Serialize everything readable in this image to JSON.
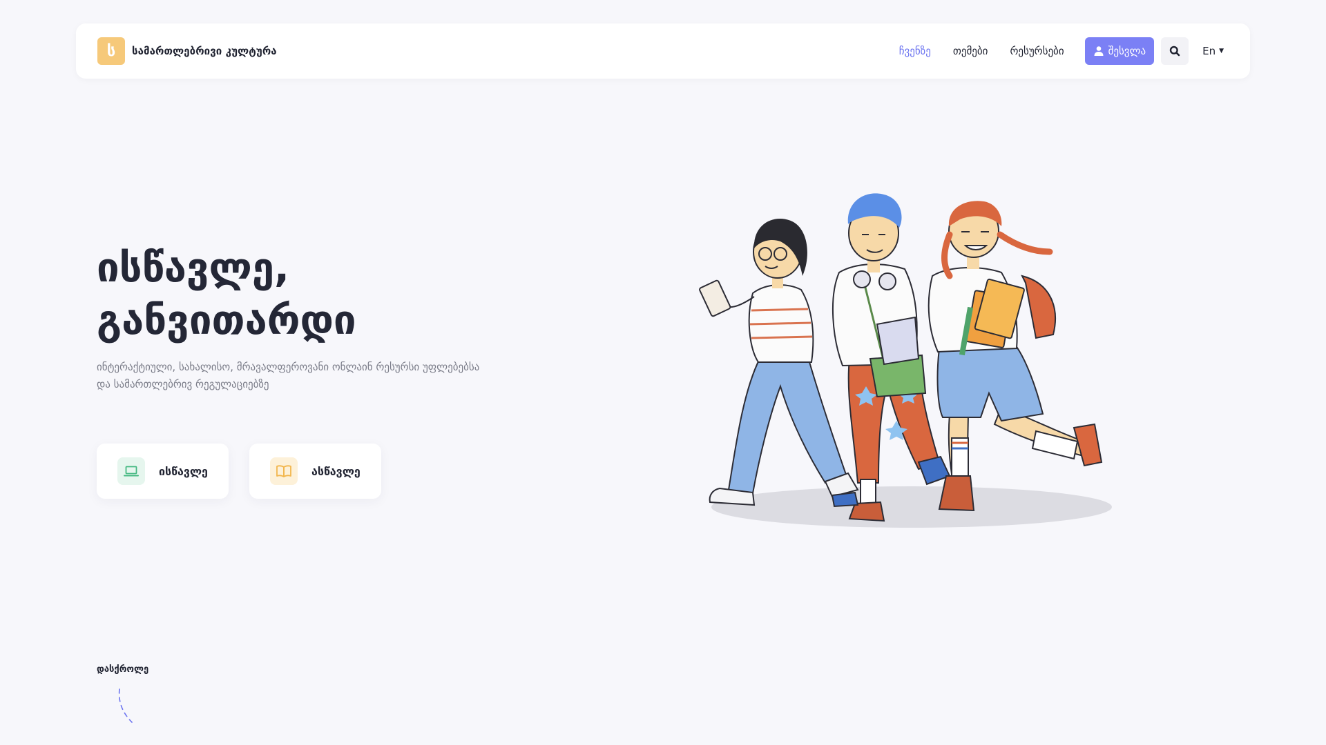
{
  "brand": {
    "logo_letter": "ს",
    "name": "სამართლებრივი კულტურა",
    "logo_color": "#f6c97a"
  },
  "nav": {
    "items": [
      {
        "label": "ჩვენზე",
        "active": true
      },
      {
        "label": "თემები",
        "active": false
      },
      {
        "label": "რესურსები",
        "active": false
      }
    ],
    "login_label": "შესვლა",
    "language": "En",
    "accent_color": "#7b80f5"
  },
  "hero": {
    "title_line1": "ისწავლე,",
    "title_line2": "განვითარდი",
    "subtitle": "ინტერაქტიული, სახალისო, მრავალფეროვანი ონლაინ რესურსი უფლებებსა და სამართლებრივ რეგულაციებზე"
  },
  "cards": [
    {
      "label": "ისწავლე",
      "icon": "laptop-icon"
    },
    {
      "label": "ასწავლე",
      "icon": "book-icon"
    }
  ],
  "scroll_hint": "დასქროლე"
}
